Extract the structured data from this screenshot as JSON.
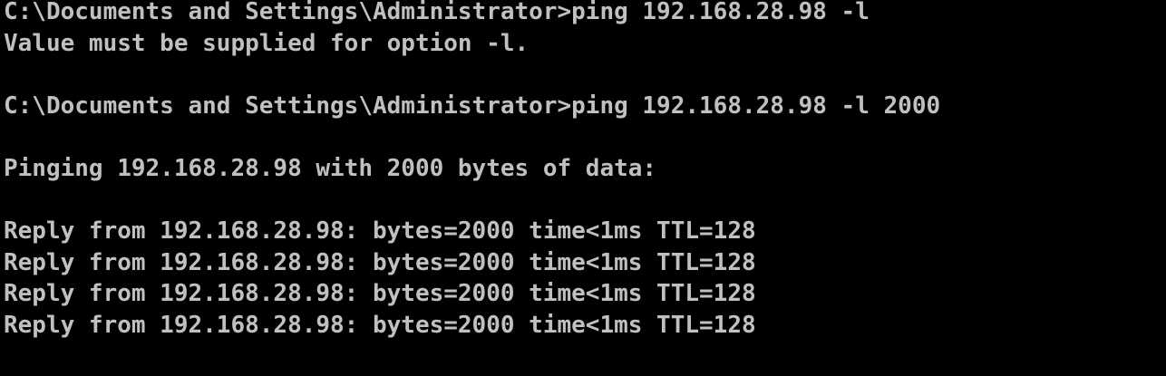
{
  "console": {
    "lines": [
      "C:\\Documents and Settings\\Administrator>ping 192.168.28.98 -l",
      "Value must be supplied for option -l.",
      "",
      "C:\\Documents and Settings\\Administrator>ping 192.168.28.98 -l 2000",
      "",
      "Pinging 192.168.28.98 with 2000 bytes of data:",
      "",
      "Reply from 192.168.28.98: bytes=2000 time<1ms TTL=128",
      "Reply from 192.168.28.98: bytes=2000 time<1ms TTL=128",
      "Reply from 192.168.28.98: bytes=2000 time<1ms TTL=128",
      "Reply from 192.168.28.98: bytes=2000 time<1ms TTL=128"
    ]
  },
  "colors": {
    "background": "#000000",
    "text": "#c0c0c0"
  }
}
